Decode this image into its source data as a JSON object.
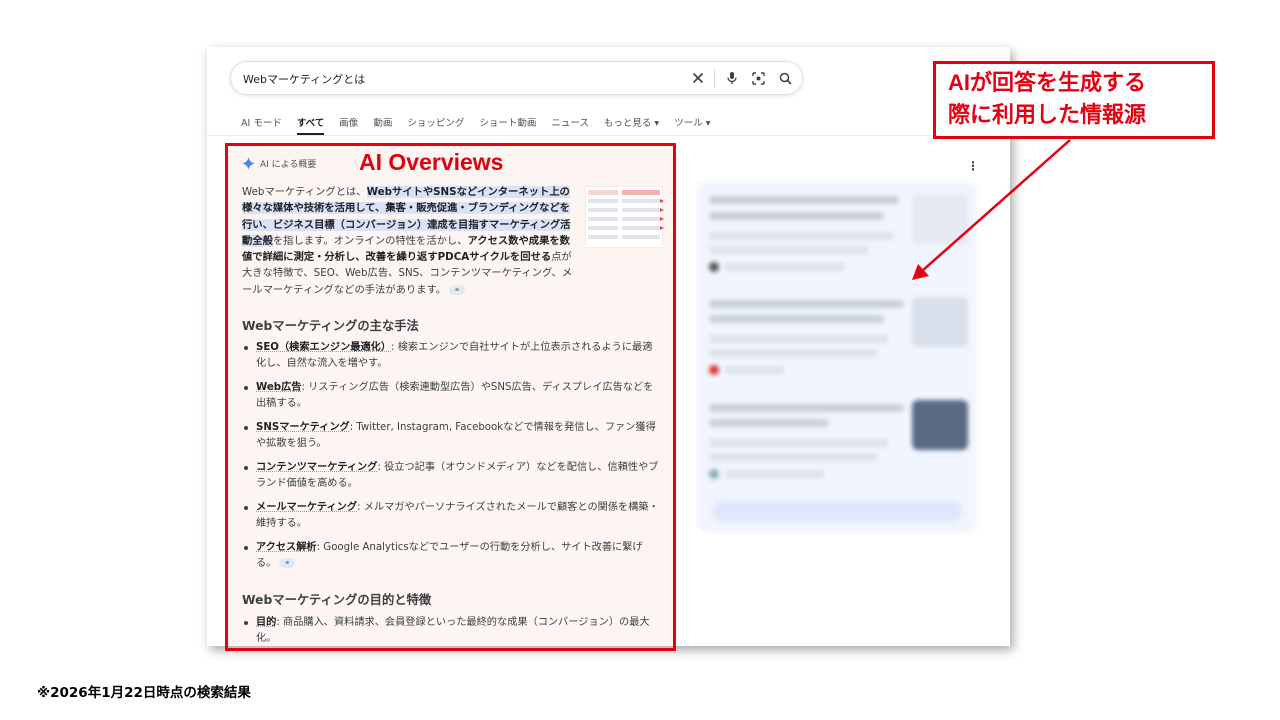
{
  "search": {
    "query": "Webマーケティングとは"
  },
  "tabs": [
    {
      "label": "AI モード"
    },
    {
      "label": "すべて"
    },
    {
      "label": "画像"
    },
    {
      "label": "動画"
    },
    {
      "label": "ショッピング"
    },
    {
      "label": "ショート動画"
    },
    {
      "label": "ニュース"
    },
    {
      "label": "もっと見る ▾"
    },
    {
      "label": "ツール ▾"
    }
  ],
  "overview": {
    "header": "AI による概要",
    "badge": "AI Overviews",
    "intro_plain_1": "Webマーケティングとは、",
    "intro_hl": "WebサイトやSNSなどインターネット上の様々な媒体や技術を活用して、集客・販売促進・ブランディングなどを行い、ビジネス目標（コンバージョン）達成を目指すマーケティング活動全般",
    "intro_plain_2": "を指します。オンラインの特性を活かし、",
    "intro_bold": "アクセス数や成果を数値で詳細に測定・分析し、改善を繰り返すPDCAサイクルを回せる",
    "intro_plain_3": "点が大きな特徴で、SEO、Web広告、SNS、コンテンツマーケティング、メールマーケティングなどの手法があります。",
    "section1_title": "Webマーケティングの主な手法",
    "methods": [
      {
        "term": "SEO（検索エンジン最適化）",
        "desc": ": 検索エンジンで自社サイトが上位表示されるように最適化し、自然な流入を増やす。"
      },
      {
        "term": "Web広告",
        "desc": ": リスティング広告（検索連動型広告）やSNS広告、ディスプレイ広告などを出稿する。"
      },
      {
        "term": "SNSマーケティング",
        "desc": ": Twitter, Instagram, Facebookなどで情報を発信し、ファン獲得や拡散を狙う。"
      },
      {
        "term": "コンテンツマーケティング",
        "desc": ": 役立つ記事（オウンドメディア）などを配信し、信頼性やブランド価値を高める。"
      },
      {
        "term": "メールマーケティング",
        "desc": ": メルマガやパーソナライズされたメールで顧客との関係を構築・維持する。"
      },
      {
        "term": "アクセス解析",
        "desc": ": Google Analyticsなどでユーザーの行動を分析し、サイト改善に繋げる。"
      }
    ],
    "section2_title": "Webマーケティングの目的と特徴",
    "purpose": [
      {
        "term": "目的",
        "desc": ": 商品購入、資料請求、会員登録といった最終的な成果（コンバージョン）の最大化。"
      }
    ]
  },
  "callout": {
    "line1": "AIが回答を生成する",
    "line2": "際に利用した情報源"
  },
  "footnote": "※2026年1月22日時点の検索結果",
  "colors": {
    "annotation_red": "#e60012",
    "overview_bg": "#fcf5f2",
    "highlight": "#d9e2f8"
  }
}
